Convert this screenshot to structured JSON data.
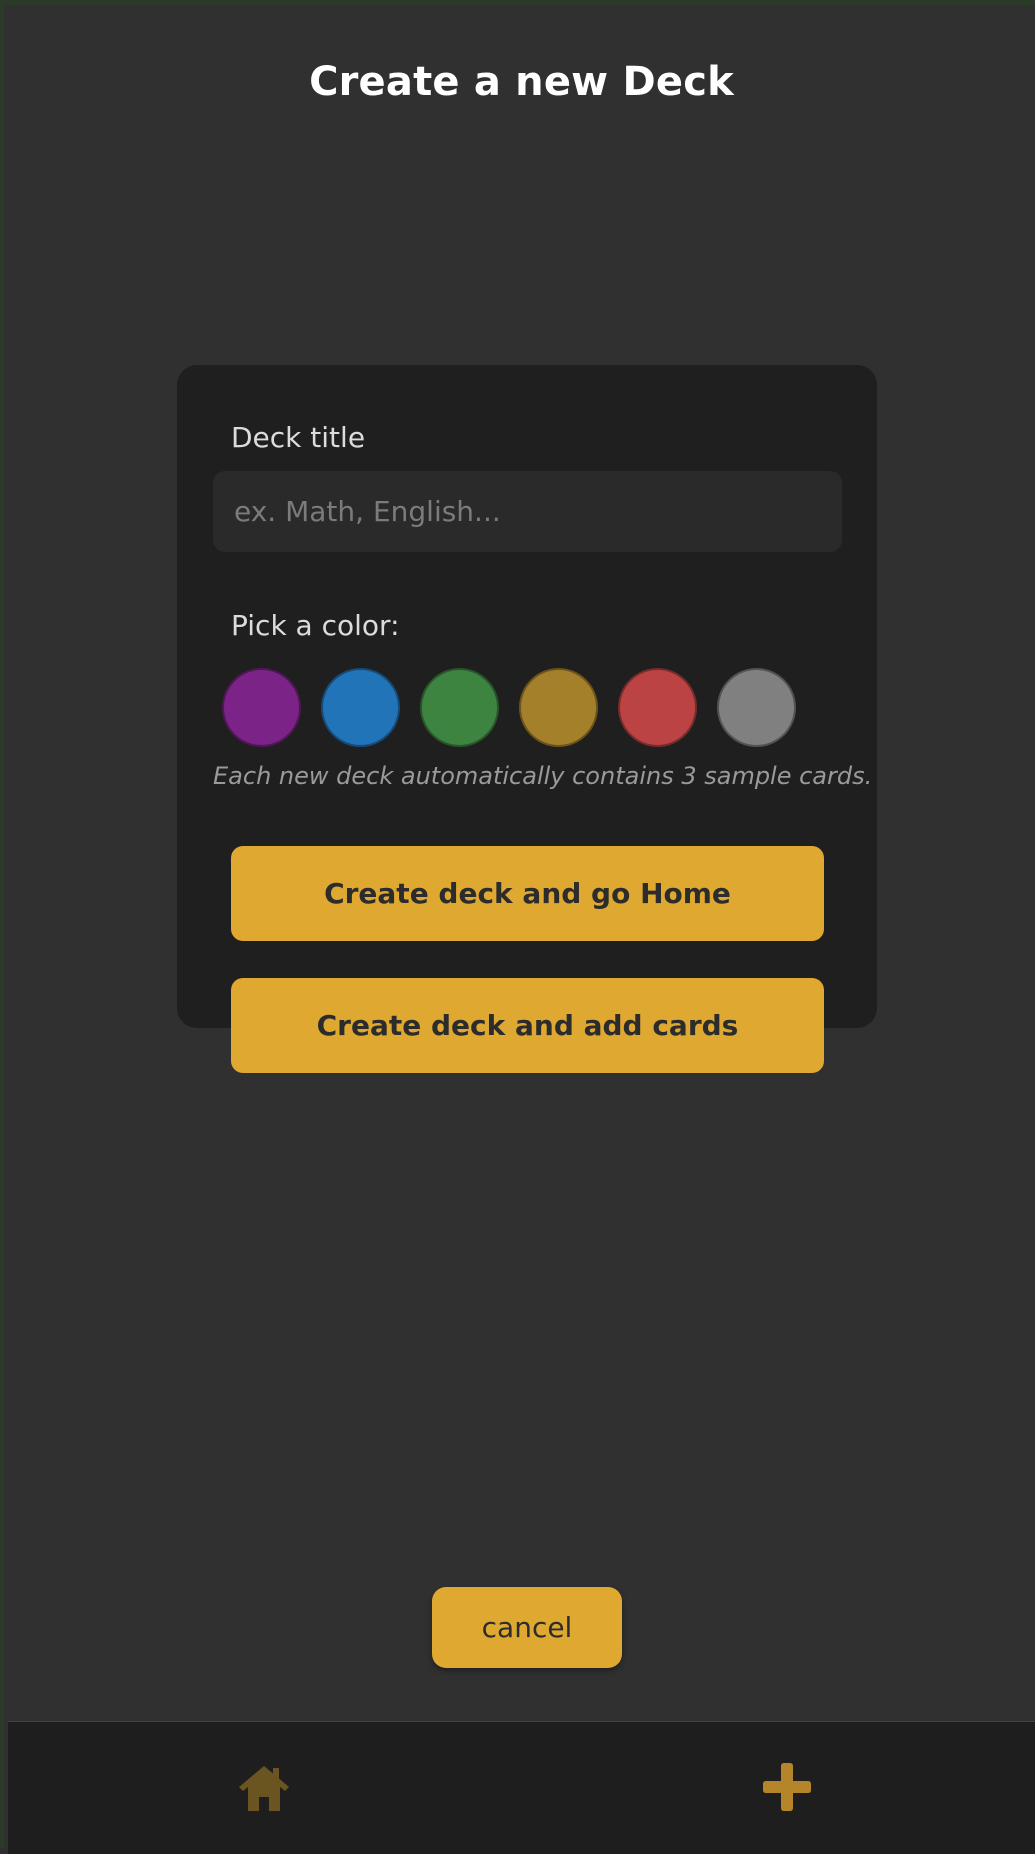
{
  "header": {
    "title": "Create a new Deck"
  },
  "form": {
    "title_label": "Deck title",
    "title_value": "",
    "title_placeholder": "ex. Math, English...",
    "color_label": "Pick a color:",
    "colors": [
      {
        "name": "purple",
        "hex": "#7b2386"
      },
      {
        "name": "blue",
        "hex": "#2274b8"
      },
      {
        "name": "green",
        "hex": "#3d8440"
      },
      {
        "name": "gold",
        "hex": "#a5802a"
      },
      {
        "name": "red",
        "hex": "#bb4343"
      },
      {
        "name": "gray",
        "hex": "#808080"
      }
    ],
    "hint": "Each new deck automatically contains 3 sample cards.",
    "create_home_label": "Create deck and go Home",
    "create_add_label": "Create deck and add cards"
  },
  "cancel_label": "cancel",
  "nav": {
    "home_icon": "home-icon",
    "add_icon": "plus-icon",
    "icon_color": "#6a5420",
    "add_color": "#b58529"
  },
  "theme": {
    "accent": "#dfa931",
    "background": "#303030",
    "card": "#1f1f1f"
  }
}
